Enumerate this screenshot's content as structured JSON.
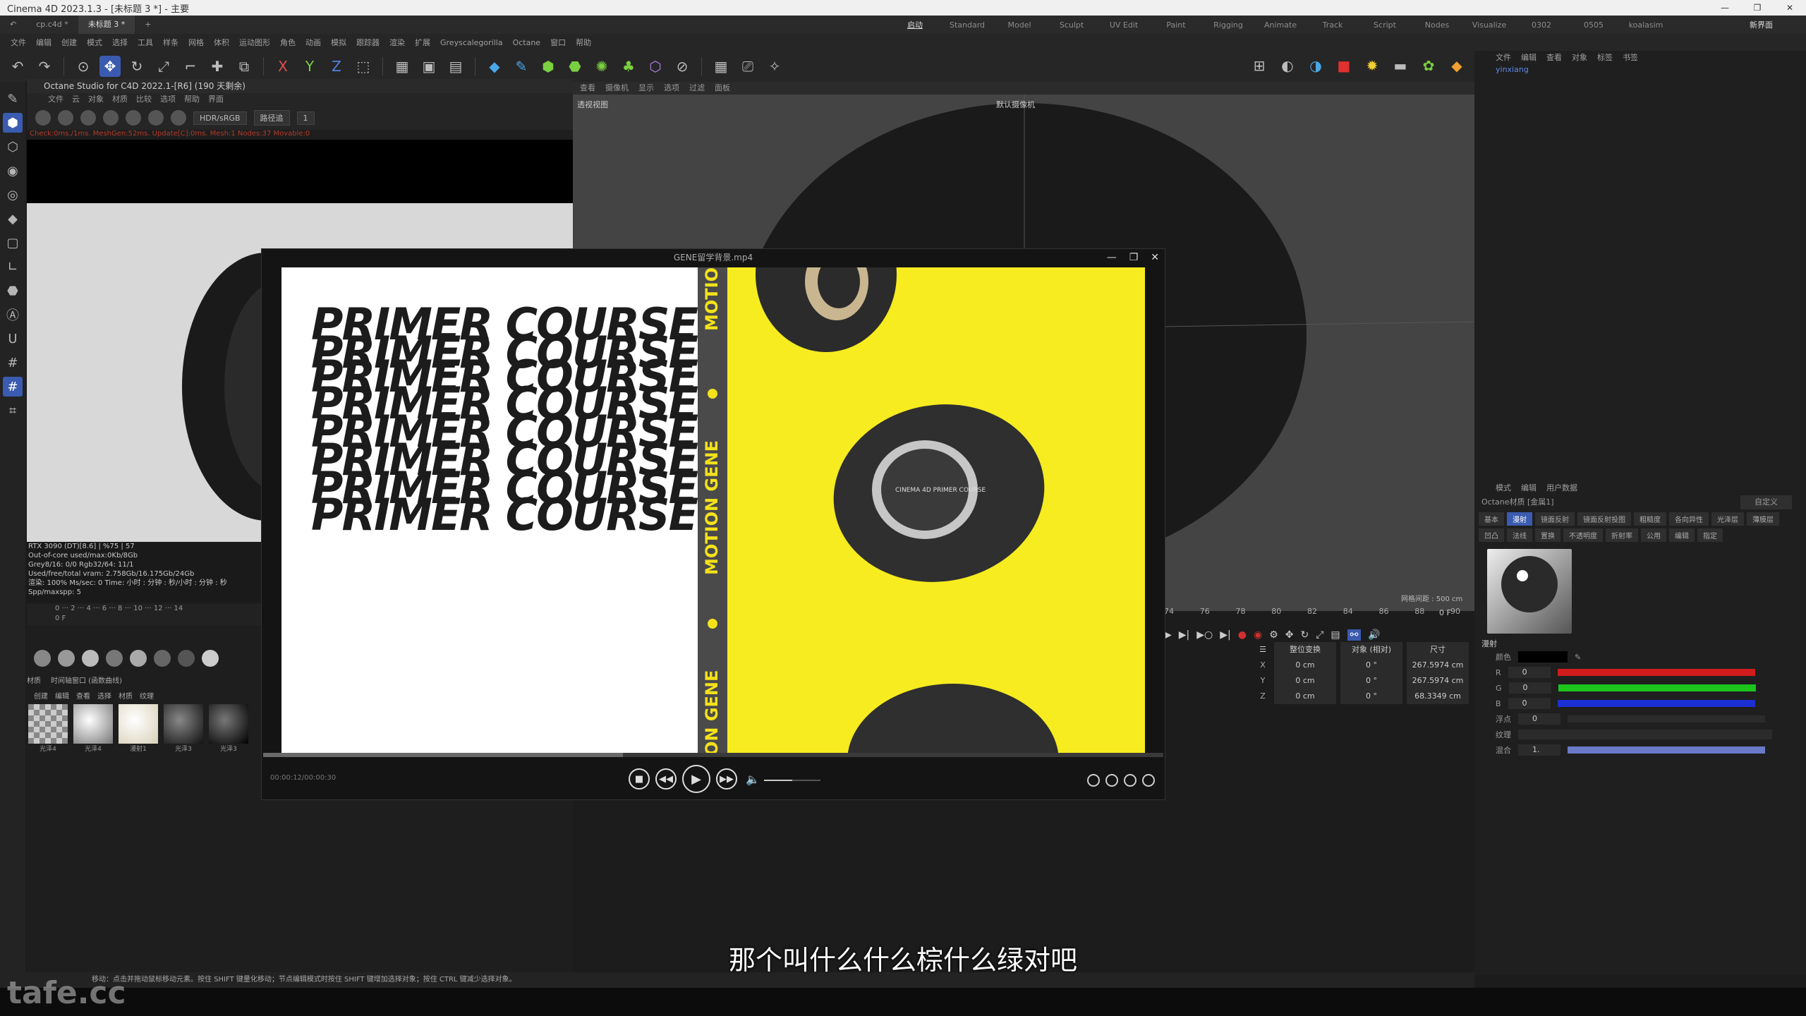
{
  "window": {
    "title": "Cinema 4D 2023.1.3 - [未标题 3 *] - 主要"
  },
  "doc_tabs": [
    "cp.c4d *",
    "未标题 3 *"
  ],
  "layout_tabs": [
    "启动",
    "Standard",
    "Model",
    "Sculpt",
    "UV Edit",
    "Paint",
    "Rigging",
    "Animate",
    "Track",
    "Script",
    "Nodes",
    "Visualize",
    "0302",
    "0505",
    "koalasim"
  ],
  "layout_right": [
    "新界面"
  ],
  "menu": [
    "文件",
    "编辑",
    "创建",
    "模式",
    "选择",
    "工具",
    "样条",
    "网格",
    "体积",
    "运动图形",
    "角色",
    "动画",
    "模拟",
    "跟踪器",
    "渲染",
    "扩展",
    "Greyscalegorilla",
    "Octane",
    "窗口",
    "帮助"
  ],
  "octane": {
    "title": "Octane Studio for C4D 2022.1-[R6] (190 天剩余)",
    "menu": [
      "文件",
      "云",
      "对象",
      "材质",
      "比较",
      "选项",
      "帮助",
      "界面"
    ],
    "color_mode": "HDR/sRGB",
    "pass_mode": "路径追",
    "pass_value": "1",
    "status": "Check:0ms./1ms. MeshGen:52ms. Update[C]:0ms. Mesh:1 Nodes:37 Movable:0",
    "stats": [
      "RTX 3090 (DT)[8.6]  |  %75  |  57",
      "Out-of-core used/max:0Kb/8Gb",
      "Grey8/16: 0/0         Rgb32/64: 11/1",
      "Used/free/total vram: 2.758Gb/16.175Gb/24Gb",
      "渲染: 100%  Ms/sec: 0  Time: 小时 : 分钟 : 秒/小时 : 分钟 : 秒  Spp/maxspp: 5"
    ],
    "timeline_frame": "0 F",
    "mat_tabs": [
      "材质",
      "时间轴窗口 (函数曲线)"
    ],
    "mat_menu": [
      "创建",
      "编辑",
      "查看",
      "选择",
      "材质",
      "纹理"
    ],
    "materials": [
      "光泽4",
      "光泽4",
      "漫射1",
      "光泽3",
      "光泽3"
    ]
  },
  "viewport": {
    "menu": [
      "查看",
      "摄像机",
      "显示",
      "选项",
      "过滤",
      "面板"
    ],
    "label": "透视视图",
    "camera": "默认摄像机",
    "grid": "网格间距 : 500 cm"
  },
  "player": {
    "title": "GENE留学背景.mp4",
    "time": "00:00:12/00:00:30",
    "progress": 0.4,
    "volume": 0.5,
    "primer_lines": [
      "PRIMER COURSE",
      "PRIMER COURSE",
      "PRIMER COURSE",
      "PRIMER COURSE",
      "PRIMER COURSE",
      "PRIMER COURSE",
      "PRIMER COURSE",
      "PRIMER COURSE"
    ],
    "strip_texts": [
      "MOTIO",
      "MOTION GENE",
      "ON GENE"
    ],
    "coin_text": "CINEMA 4D PRIMER COURSE"
  },
  "right_panel": {
    "menu": [
      "文件",
      "编辑",
      "查看",
      "对象",
      "标签",
      "书签"
    ],
    "object": "yinxiang",
    "attr_menu": [
      "模式",
      "编辑",
      "用户数据"
    ],
    "material_name": "Octane材质 [金属1]",
    "preset": "自定义",
    "attr_tabs": [
      "基本",
      "漫射",
      "镜面反射",
      "镜面反射投图",
      "粗糙度",
      "各向异性",
      "光泽层",
      "薄膜层",
      "凹凸",
      "法线",
      "置换",
      "不透明度",
      "折射率",
      "公用",
      "编辑",
      "指定"
    ],
    "section": "漫射",
    "color_label": "颜色",
    "rgb": [
      {
        "label": "R",
        "value": "0"
      },
      {
        "label": "G",
        "value": "0"
      },
      {
        "label": "B",
        "value": "0"
      }
    ],
    "float_label": "浮点",
    "float_value": "0",
    "texture_label": "纹理",
    "mix_label": "混合",
    "mix_value": "1."
  },
  "coords": {
    "header": [
      "整位变换",
      "对象 (相对)",
      "尺寸"
    ],
    "rows": [
      {
        "axis": "X",
        "pos": "0 cm",
        "rot": "0 °",
        "size": "267.5974 cm"
      },
      {
        "axis": "Y",
        "pos": "0 cm",
        "rot": "0 °",
        "size": "267.5974 cm"
      },
      {
        "axis": "Z",
        "pos": "0 cm",
        "rot": "0 °",
        "size": "68.3349 cm"
      }
    ],
    "timeline_numbers": [
      "74",
      "76",
      "78",
      "80",
      "82",
      "84",
      "86",
      "88",
      "90"
    ],
    "frame": "0 F"
  },
  "status_bar": "移动：点击并拖动鼠标移动元素。按住 SHIFT 键量化移动；节点编辑模式时按住 SHIFT 键增加选择对象；按住 CTRL 键减少选择对象。",
  "watermark": "tafe.cc",
  "subtitle": "那个叫什么什么棕什么绿对吧",
  "colors": {
    "accent": "#3a5bb0",
    "video_yellow": "#f6ec1f",
    "red": "#d21c1c",
    "green": "#1cc41c",
    "blue": "#1c2fd2"
  }
}
